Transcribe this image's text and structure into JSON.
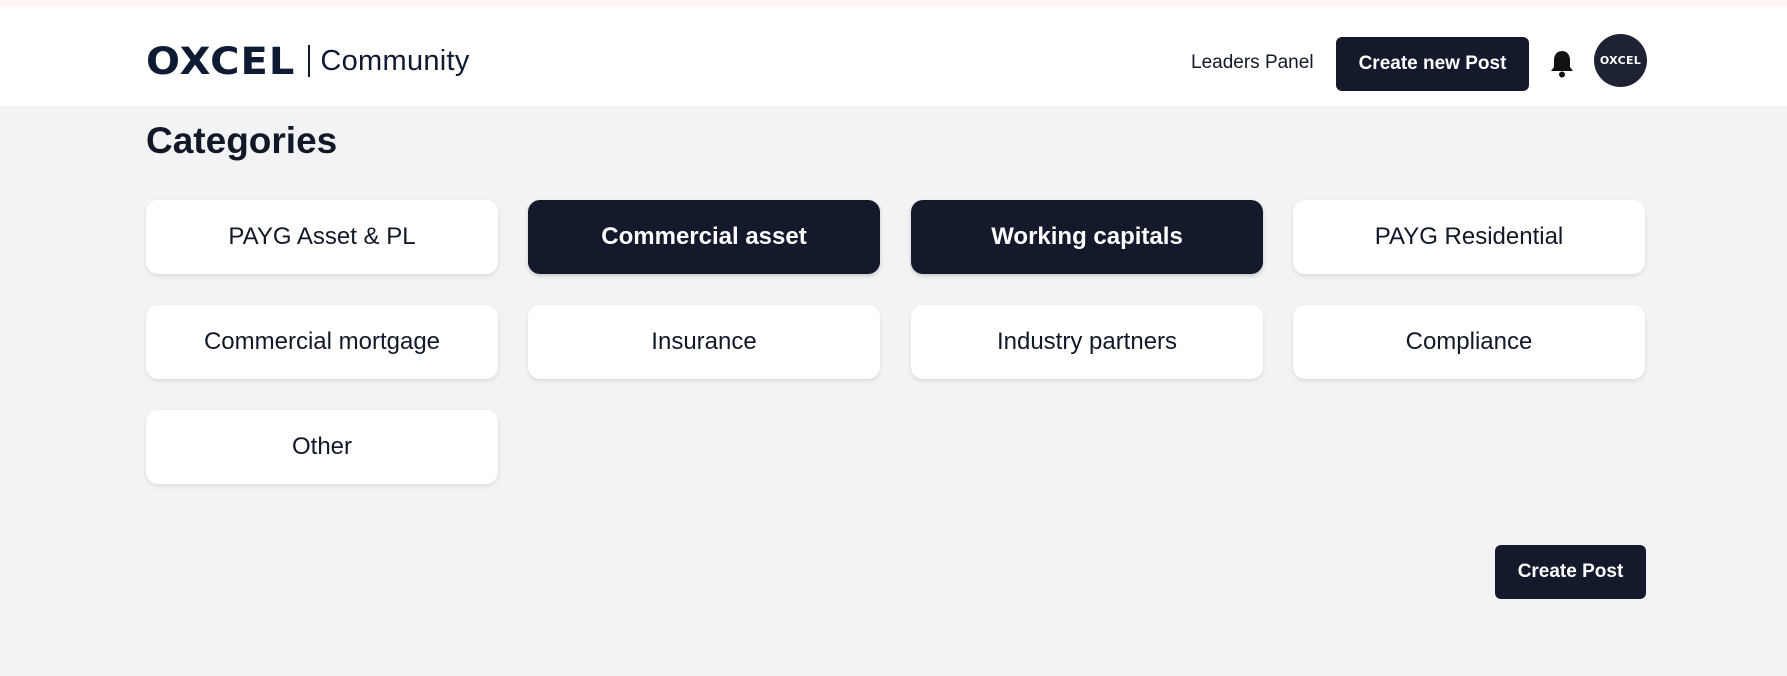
{
  "header": {
    "logo_word": "OXCEL",
    "logo_sub": "Community",
    "leaders_panel": "Leaders Panel",
    "create_new_post": "Create new Post",
    "avatar_text": "OXCEL"
  },
  "main": {
    "title": "Categories",
    "categories": [
      {
        "label": "PAYG Asset & PL",
        "active": false
      },
      {
        "label": "Commercial asset",
        "active": true
      },
      {
        "label": "Working capitals",
        "active": true
      },
      {
        "label": "PAYG Residential",
        "active": false
      },
      {
        "label": "Commercial mortgage",
        "active": false
      },
      {
        "label": "Insurance",
        "active": false
      },
      {
        "label": "Industry partners",
        "active": false
      },
      {
        "label": "Compliance",
        "active": false
      },
      {
        "label": "Other",
        "active": false
      }
    ],
    "create_post": "Create Post"
  },
  "icons": {
    "bell": "bell-icon"
  },
  "colors": {
    "brand_dark": "#141a2b",
    "background": "#f2f3f5",
    "card": "#ffffff"
  }
}
